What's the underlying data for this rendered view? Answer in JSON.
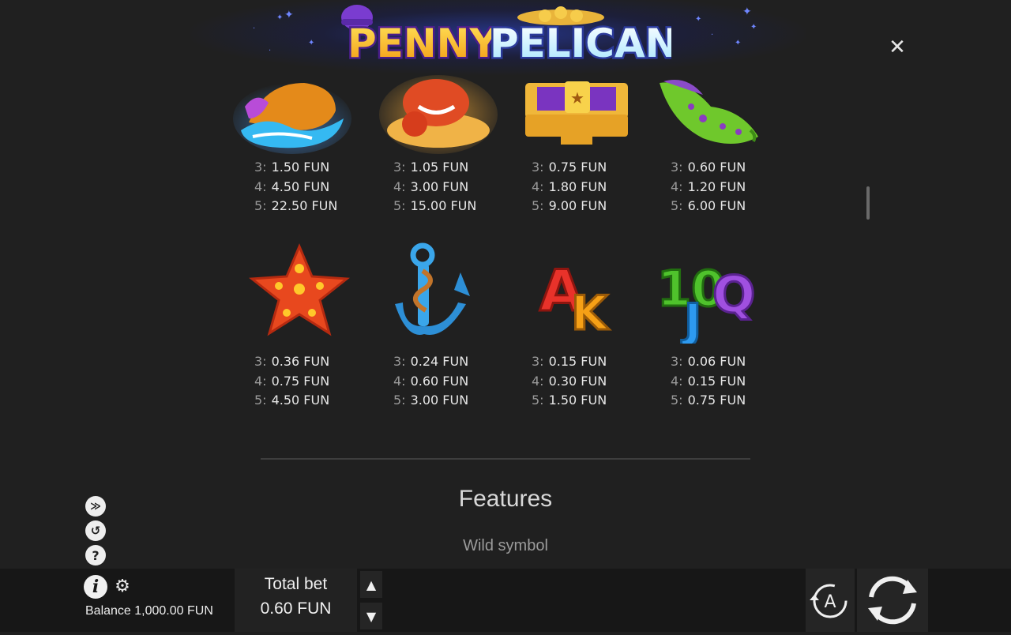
{
  "game": {
    "title": "PENNY PELICAN"
  },
  "close_icon": "close-icon",
  "paytable": {
    "row1": [
      {
        "name": "wave-fish-symbol",
        "pays": [
          {
            "count": "3:",
            "value": "1.50 FUN"
          },
          {
            "count": "4:",
            "value": "4.50 FUN"
          },
          {
            "count": "5:",
            "value": "22.50 FUN"
          }
        ]
      },
      {
        "name": "crab-symbol",
        "pays": [
          {
            "count": "3:",
            "value": "1.05 FUN"
          },
          {
            "count": "4:",
            "value": "3.00 FUN"
          },
          {
            "count": "5:",
            "value": "15.00 FUN"
          }
        ]
      },
      {
        "name": "treasure-chest-symbol",
        "pays": [
          {
            "count": "3:",
            "value": "0.75 FUN"
          },
          {
            "count": "4:",
            "value": "1.80 FUN"
          },
          {
            "count": "5:",
            "value": "9.00 FUN"
          }
        ]
      },
      {
        "name": "seashell-symbol",
        "pays": [
          {
            "count": "3:",
            "value": "0.60 FUN"
          },
          {
            "count": "4:",
            "value": "1.20 FUN"
          },
          {
            "count": "5:",
            "value": "6.00 FUN"
          }
        ]
      }
    ],
    "row2": [
      {
        "name": "starfish-symbol",
        "pays": [
          {
            "count": "3:",
            "value": "0.36 FUN"
          },
          {
            "count": "4:",
            "value": "0.75 FUN"
          },
          {
            "count": "5:",
            "value": "4.50 FUN"
          }
        ]
      },
      {
        "name": "anchor-symbol",
        "pays": [
          {
            "count": "3:",
            "value": "0.24 FUN"
          },
          {
            "count": "4:",
            "value": "0.60 FUN"
          },
          {
            "count": "5:",
            "value": "3.00 FUN"
          }
        ]
      },
      {
        "name": "a-k-symbol",
        "letters": [
          "A",
          "K"
        ],
        "pays": [
          {
            "count": "3:",
            "value": "0.15 FUN"
          },
          {
            "count": "4:",
            "value": "0.30 FUN"
          },
          {
            "count": "5:",
            "value": "1.50 FUN"
          }
        ]
      },
      {
        "name": "10-j-q-symbol",
        "letters": [
          "10",
          "J",
          "Q"
        ],
        "pays": [
          {
            "count": "3:",
            "value": "0.06 FUN"
          },
          {
            "count": "4:",
            "value": "0.15 FUN"
          },
          {
            "count": "5:",
            "value": "0.75 FUN"
          }
        ]
      }
    ]
  },
  "features": {
    "title": "Features",
    "subtitle": "Wild symbol"
  },
  "side_icons": [
    "turbo-icon",
    "history-icon",
    "help-icon"
  ],
  "bottom": {
    "balance_label": "Balance 1,000.00 FUN",
    "bet_label": "Total bet",
    "bet_value": "0.60 FUN",
    "auto_label": "A"
  },
  "colors": {
    "background": "#202020",
    "bar": "#171717",
    "accent_blue": "#3a4cc0"
  }
}
